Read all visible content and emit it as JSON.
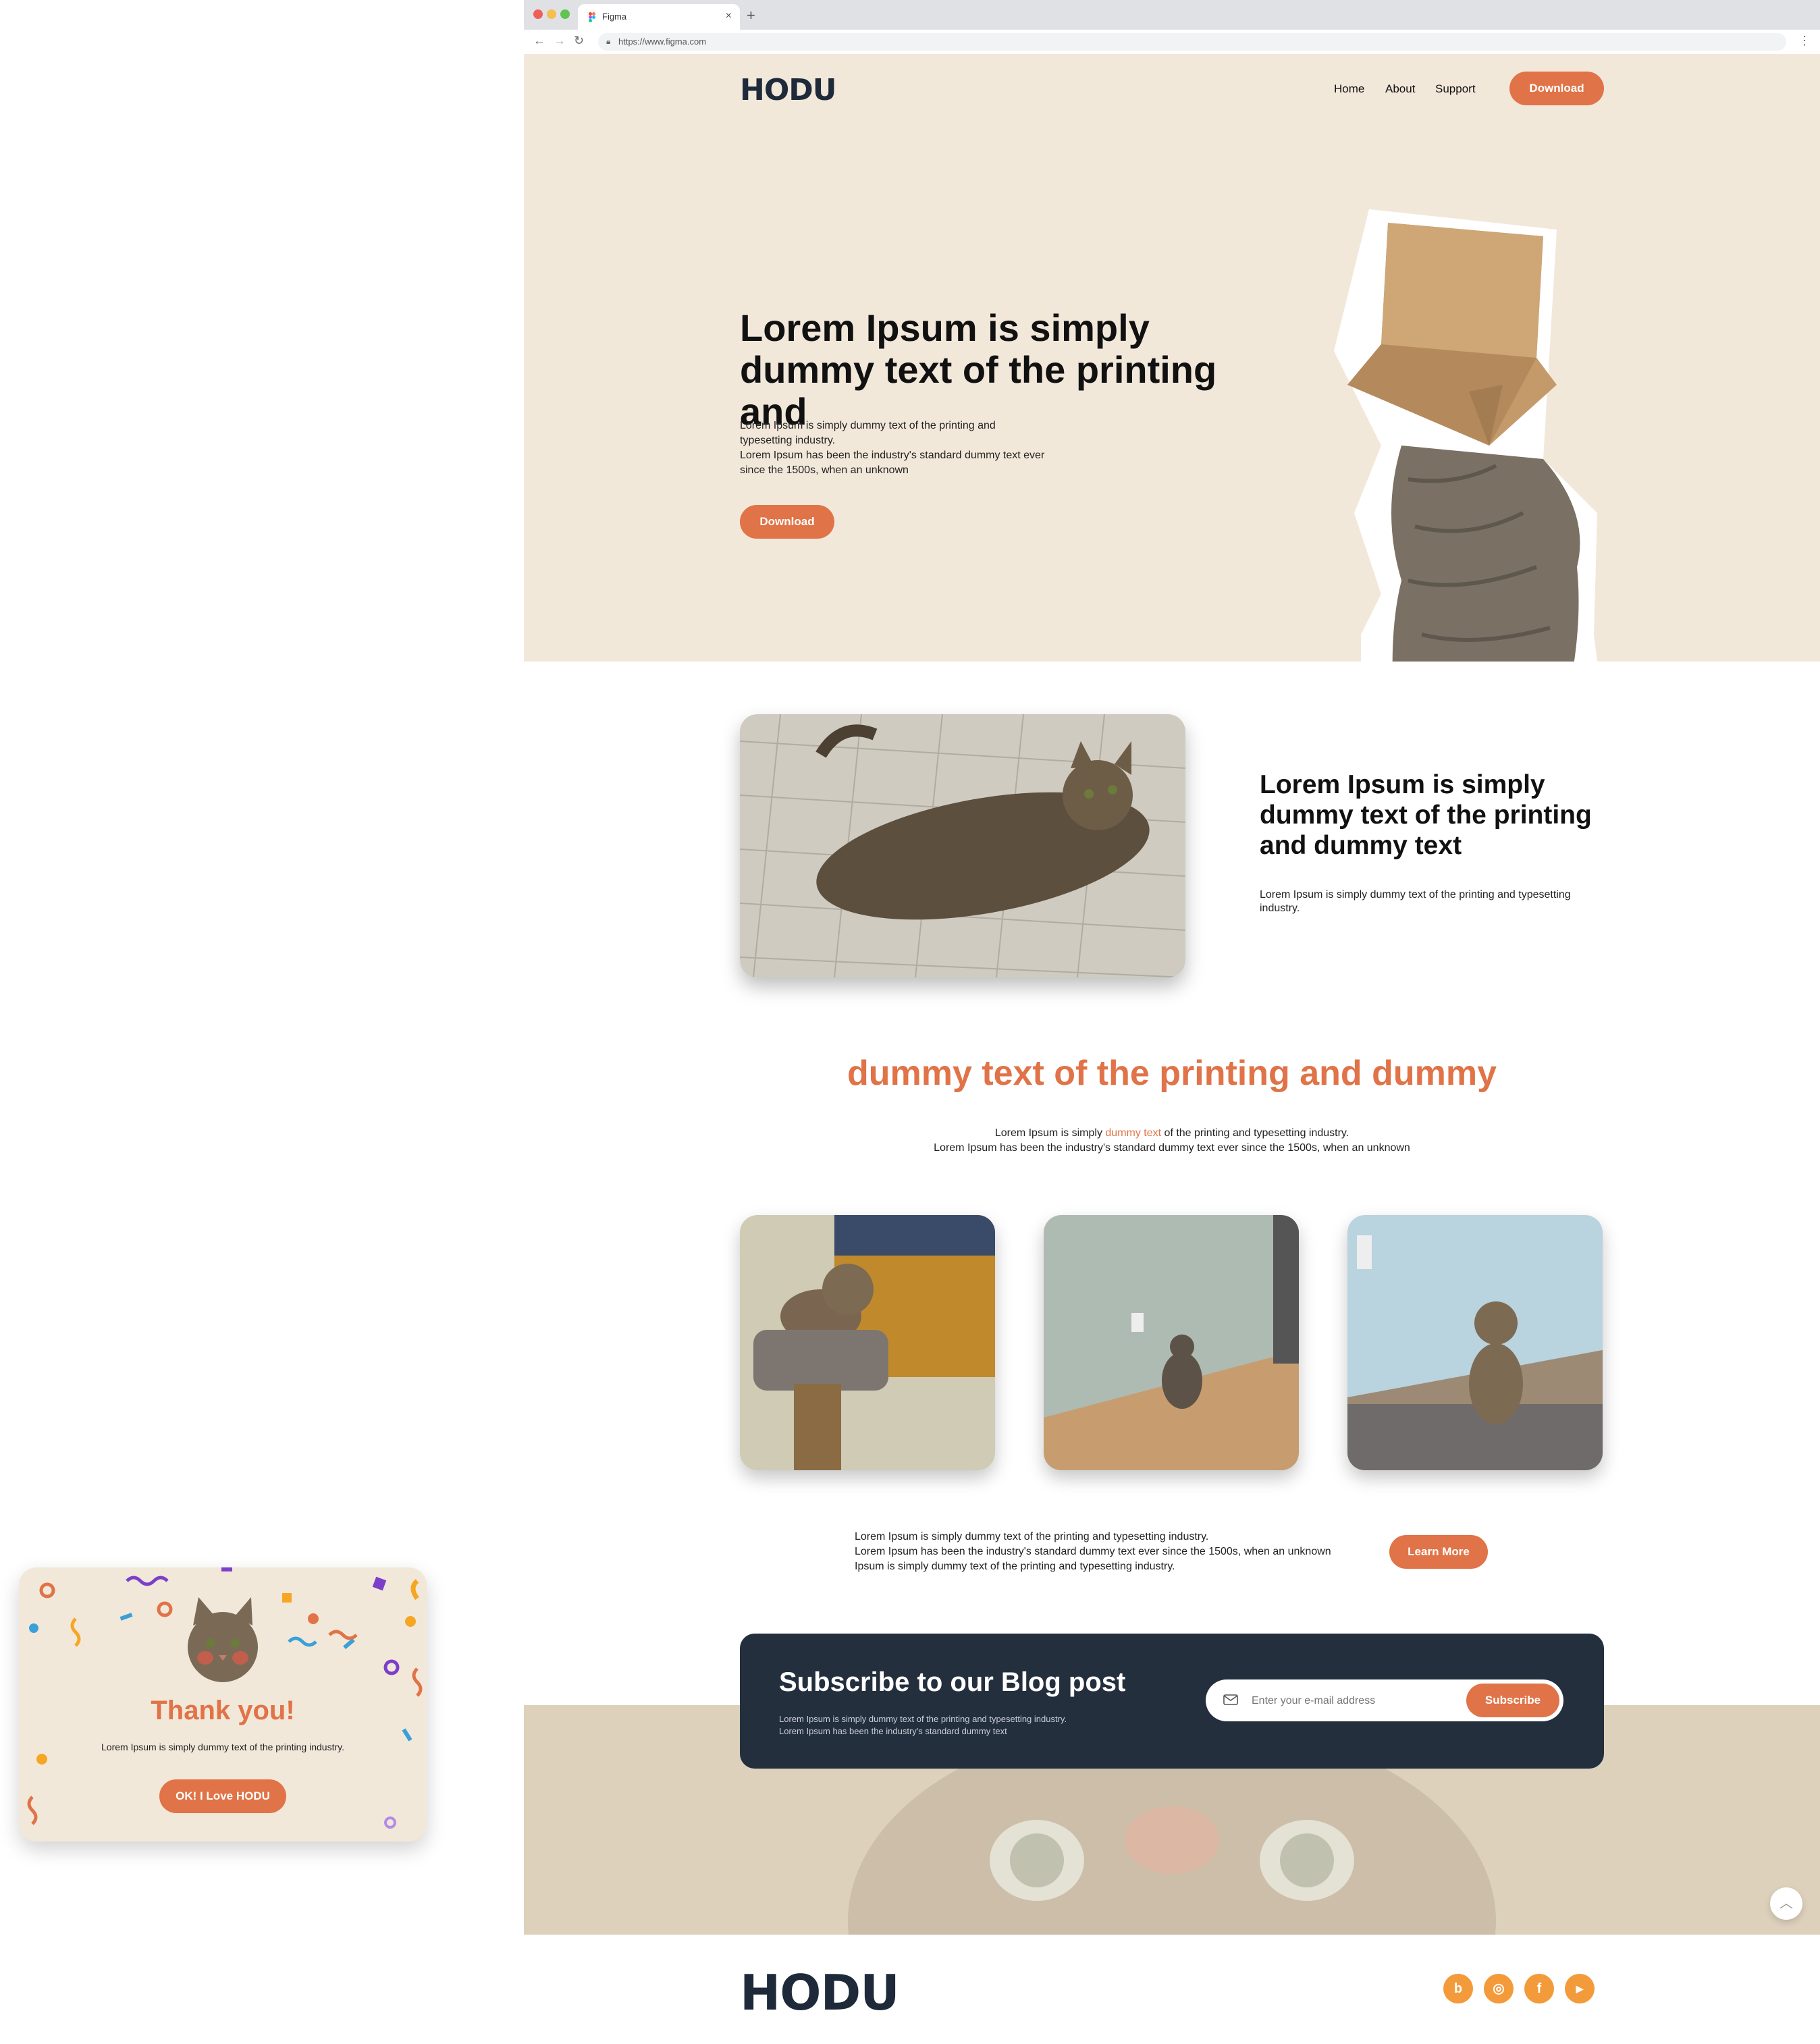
{
  "browser": {
    "tab_title": "Figma",
    "tab_close": "×",
    "new_tab": "+",
    "back": "←",
    "forward": "→",
    "reload": "↻",
    "url": "https://www.figma.com",
    "menu": "⋮"
  },
  "header": {
    "logo": "HODU",
    "nav": [
      "Home",
      "About",
      "Support"
    ],
    "download": "Download"
  },
  "hero": {
    "heading": "Lorem Ipsum is simply dummy text of the printing and",
    "paragraph_1": "Lorem Ipsum is simply dummy text of the printing and typesetting industry.",
    "paragraph_2": "Lorem Ipsum has been the industry's standard dummy text ever since the 1500s, when an unknown",
    "download": "Download"
  },
  "feature": {
    "heading": "Lorem Ipsum is simply dummy text of the printing and dummy text",
    "paragraph": "Lorem Ipsum is simply dummy text of the printing and typesetting industry."
  },
  "center": {
    "heading": "dummy text of the printing and dummy",
    "line1_before": "Lorem Ipsum is simply ",
    "line1_highlight": "dummy text",
    "line1_after": " of the printing and typesetting industry.",
    "line2": "Lorem Ipsum has been the industry's standard dummy text ever since the 1500s, when an unknown"
  },
  "learn": {
    "line1": "Lorem Ipsum is simply dummy text of the printing and typesetting industry.",
    "line2": "Lorem Ipsum has been the industry's standard dummy text ever since the 1500s, when an unknown",
    "line3": "Ipsum is simply dummy text of the printing and typesetting industry.",
    "button": "Learn More"
  },
  "subscribe": {
    "heading": "Subscribe to our Blog post",
    "line1": "Lorem Ipsum is simply dummy text of the printing and typesetting industry.",
    "line2": "Lorem Ipsum has been the industry's standard dummy text",
    "placeholder": "Enter your e-mail address",
    "button": "Subscribe"
  },
  "scroll_top": "︿",
  "footer": {
    "logo": "HODU",
    "social": [
      {
        "icon": "blog-icon",
        "glyph": "b"
      },
      {
        "icon": "instagram-icon",
        "glyph": "◎"
      },
      {
        "icon": "facebook-icon",
        "glyph": "f"
      },
      {
        "icon": "youtube-icon",
        "glyph": "▶"
      }
    ]
  },
  "modal": {
    "heading": "Thank you!",
    "paragraph": "Lorem Ipsum is simply dummy text of the printing industry.",
    "button": "OK! I Love HODU"
  },
  "colors": {
    "accent": "#e07347",
    "hero_bg": "#f2e8da",
    "dark": "#242f3e",
    "social": "#f39a3a"
  }
}
